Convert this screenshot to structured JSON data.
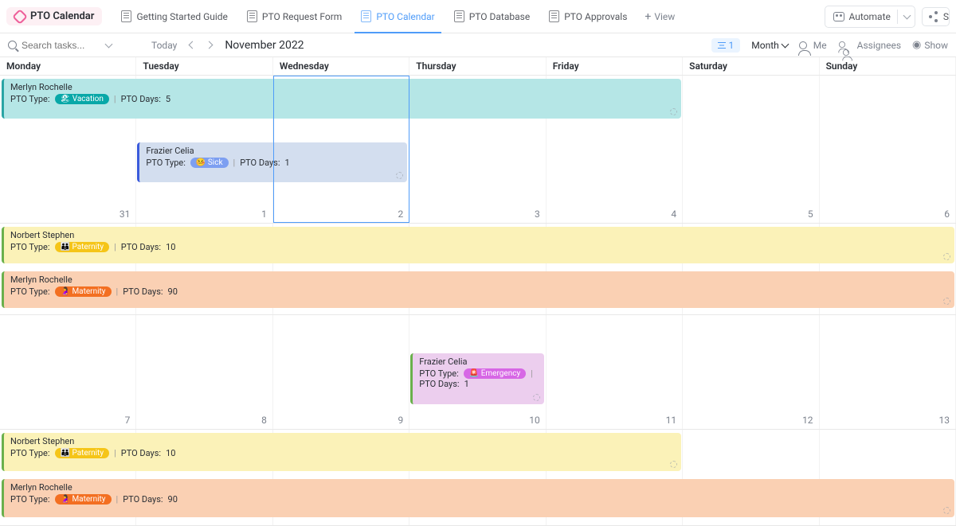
{
  "header": {
    "title": "PTO Calendar",
    "tabs": [
      {
        "label": "Getting Started Guide"
      },
      {
        "label": "PTO Request Form"
      },
      {
        "label": "PTO Calendar"
      },
      {
        "label": "PTO Database"
      },
      {
        "label": "PTO Approvals"
      }
    ],
    "add_view": "View",
    "automate": "Automate",
    "share": "S"
  },
  "toolbar": {
    "search_placeholder": "Search tasks...",
    "today": "Today",
    "month_year": "November 2022",
    "filter_count": "1",
    "view_mode": "Month",
    "me": "Me",
    "assignees": "Assignees",
    "show": "Show"
  },
  "days": [
    "Monday",
    "Tuesday",
    "Wednesday",
    "Thursday",
    "Friday",
    "Saturday",
    "Sunday"
  ],
  "weeks": [
    {
      "height": "186",
      "nums": [
        "31",
        "1",
        "2",
        "3",
        "4",
        "5",
        "6"
      ],
      "today_idx": 2
    },
    {
      "height": "115",
      "nums": [
        "7",
        "8",
        "9",
        "10",
        "11",
        "12",
        "13"
      ]
    },
    {
      "height": "144",
      "nums": [
        "",
        "",
        "",
        "",
        "",
        "",
        ""
      ]
    },
    {
      "height": "121",
      "nums": [
        "",
        "",
        "",
        "",
        "",
        "",
        ""
      ]
    }
  ],
  "labels": {
    "pto_type": "PTO Type:",
    "pto_days": "PTO Days:"
  },
  "events": {
    "w1e1": {
      "person": "Merlyn Rochelle",
      "type": "Vacation",
      "emoji": "🏖",
      "days": "5"
    },
    "w1e2": {
      "person": "Frazier Celia",
      "type": "Sick",
      "emoji": "🤒",
      "days": "1"
    },
    "w2e1": {
      "person": "Norbert Stephen",
      "type": "Paternity",
      "emoji": "👪",
      "days": "10"
    },
    "w2e2": {
      "person": "Merlyn Rochelle",
      "type": "Maternity",
      "emoji": "🤰",
      "days": "90"
    },
    "w3e1": {
      "person": "Frazier Celia",
      "type": "Emergency",
      "emoji": "🚨",
      "days": "1"
    },
    "w4e1": {
      "person": "Norbert Stephen",
      "type": "Paternity",
      "emoji": "👪",
      "days": "10"
    },
    "w4e2": {
      "person": "Merlyn Rochelle",
      "type": "Maternity",
      "emoji": "🤰",
      "days": "90"
    }
  }
}
